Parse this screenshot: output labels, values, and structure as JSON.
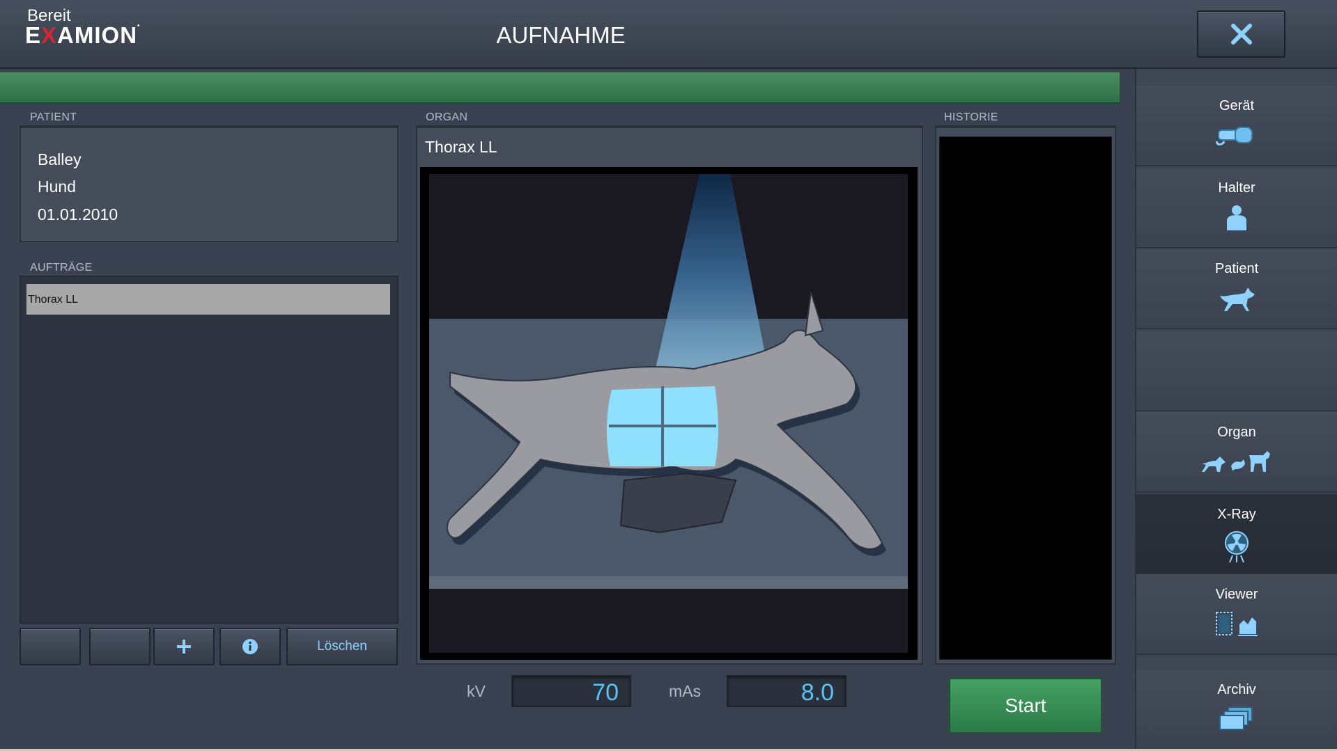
{
  "header": {
    "logo_pre": "E",
    "logo_x": "X",
    "logo_post": "AMION",
    "title": "AUFNAHME",
    "close_icon": "close-icon"
  },
  "status": {
    "text": "Bereit",
    "color": "#3d8558"
  },
  "patient": {
    "label": "PATIENT",
    "name": "Balley",
    "species": "Hund",
    "birthdate": "01.01.2010"
  },
  "auftraege": {
    "label": "AUFTRÄGE",
    "items": [
      "Thorax LL"
    ]
  },
  "buttons": {
    "loeschen": "Löschen",
    "add_icon": "plus-icon",
    "info_icon": "info-icon"
  },
  "organ": {
    "label": "ORGAN",
    "name": "Thorax LL"
  },
  "historie": {
    "label": "HISTORIE"
  },
  "exposure": {
    "kv_label": "kV",
    "kv_value": "70",
    "mas_label": "mAs",
    "mas_value": "8.0"
  },
  "start": {
    "label": "Start",
    "color": "#38905a"
  },
  "sidebar": {
    "items": [
      {
        "label": "Gerät",
        "icon": "device-icon"
      },
      {
        "label": "Halter",
        "icon": "owner-icon"
      },
      {
        "label": "Patient",
        "icon": "dog-icon"
      },
      {
        "label": "",
        "icon": ""
      },
      {
        "label": "Organ",
        "icon": "animals-icon"
      },
      {
        "label": "X-Ray",
        "icon": "radiation-icon"
      },
      {
        "label": "Viewer",
        "icon": "viewer-icon"
      },
      {
        "label": "Archiv",
        "icon": "archive-icon"
      }
    ]
  },
  "colors": {
    "accent": "#5cc3f5",
    "background": "#3a4150"
  }
}
